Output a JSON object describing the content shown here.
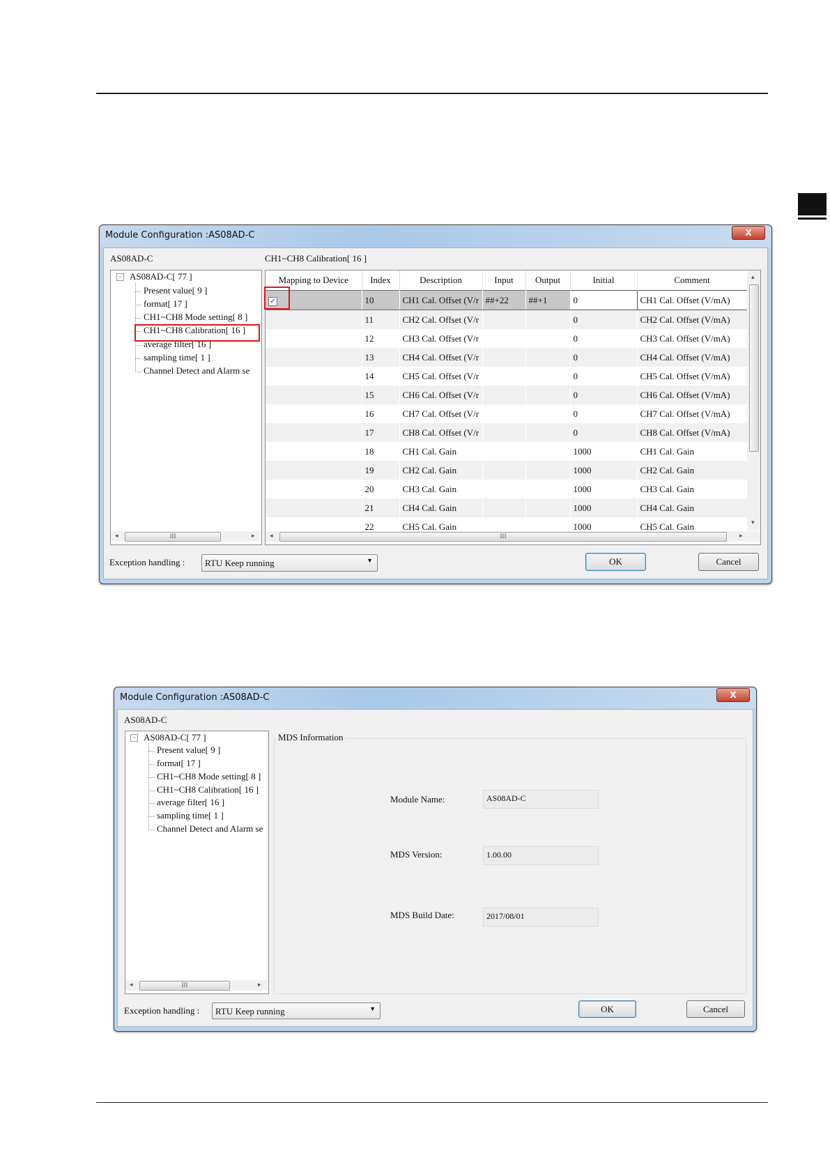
{
  "dialog1": {
    "title": "Module Configuration :AS08AD-C",
    "close_label": "X",
    "module_label": "AS08AD-C",
    "section_label": "CH1~CH8 Calibration[ 16 ]",
    "tree": {
      "root": "AS08AD-C[ 77 ]",
      "items": [
        "Present value[ 9 ]",
        "format[ 17 ]",
        "CH1~CH8 Mode setting[ 8 ]",
        "CH1~CH8 Calibration[ 16 ]",
        "average filter[ 16 ]",
        "sampling time[ 1 ]",
        "Channel Detect and Alarm se"
      ],
      "selected": "CH1~CH8 Calibration[ 16 ]"
    },
    "columns": [
      "Mapping to Device",
      "Index",
      "Description",
      "Input",
      "Output",
      "Initial",
      "Comment"
    ],
    "rows": [
      {
        "mapped": true,
        "index": "10",
        "description": "CH1 Cal. Offset (V/r",
        "input": "##+22",
        "output": "##+1",
        "initial": "0",
        "comment": "CH1 Cal. Offset (V/mA)"
      },
      {
        "mapped": false,
        "index": "11",
        "description": "CH2 Cal. Offset (V/r",
        "input": "",
        "output": "",
        "initial": "0",
        "comment": "CH2 Cal. Offset (V/mA)"
      },
      {
        "mapped": false,
        "index": "12",
        "description": "CH3 Cal. Offset (V/r",
        "input": "",
        "output": "",
        "initial": "0",
        "comment": "CH3 Cal. Offset (V/mA)"
      },
      {
        "mapped": false,
        "index": "13",
        "description": "CH4 Cal. Offset (V/r",
        "input": "",
        "output": "",
        "initial": "0",
        "comment": "CH4 Cal. Offset (V/mA)"
      },
      {
        "mapped": false,
        "index": "14",
        "description": "CH5 Cal. Offset (V/r",
        "input": "",
        "output": "",
        "initial": "0",
        "comment": "CH5 Cal. Offset (V/mA)"
      },
      {
        "mapped": false,
        "index": "15",
        "description": "CH6 Cal. Offset (V/r",
        "input": "",
        "output": "",
        "initial": "0",
        "comment": "CH6 Cal. Offset (V/mA)"
      },
      {
        "mapped": false,
        "index": "16",
        "description": "CH7 Cal. Offset (V/r",
        "input": "",
        "output": "",
        "initial": "0",
        "comment": "CH7 Cal. Offset (V/mA)"
      },
      {
        "mapped": false,
        "index": "17",
        "description": "CH8 Cal. Offset (V/r",
        "input": "",
        "output": "",
        "initial": "0",
        "comment": "CH8 Cal. Offset (V/mA)"
      },
      {
        "mapped": false,
        "index": "18",
        "description": "CH1 Cal. Gain",
        "input": "",
        "output": "",
        "initial": "1000",
        "comment": "CH1 Cal. Gain"
      },
      {
        "mapped": false,
        "index": "19",
        "description": "CH2 Cal. Gain",
        "input": "",
        "output": "",
        "initial": "1000",
        "comment": "CH2 Cal. Gain"
      },
      {
        "mapped": false,
        "index": "20",
        "description": "CH3 Cal. Gain",
        "input": "",
        "output": "",
        "initial": "1000",
        "comment": "CH3 Cal. Gain"
      },
      {
        "mapped": false,
        "index": "21",
        "description": "CH4 Cal. Gain",
        "input": "",
        "output": "",
        "initial": "1000",
        "comment": "CH4 Cal. Gain"
      },
      {
        "mapped": false,
        "index": "22",
        "description": "CH5 Cal. Gain",
        "input": "",
        "output": "",
        "initial": "1000",
        "comment": "CH5 Cal. Gain"
      }
    ],
    "exception_label": "Exception handling :",
    "exception_value": "RTU Keep running",
    "ok_label": "OK",
    "cancel_label": "Cancel"
  },
  "dialog2": {
    "title": "Module Configuration :AS08AD-C",
    "close_label": "X",
    "module_label": "AS08AD-C",
    "tree": {
      "root": "AS08AD-C[ 77 ]",
      "items": [
        "Present value[ 9 ]",
        "format[ 17 ]",
        "CH1~CH8 Mode setting[ 8 ]",
        "CH1~CH8 Calibration[ 16 ]",
        "average filter[ 16 ]",
        "sampling time[ 1 ]",
        "Channel Detect and Alarm se"
      ]
    },
    "group_title": "MDS Information",
    "fields": [
      {
        "label": "Module Name:",
        "value": "AS08AD-C"
      },
      {
        "label": "MDS Version:",
        "value": "1.00.00"
      },
      {
        "label": "MDS Build Date:",
        "value": "2017/08/01"
      }
    ],
    "exception_label": "Exception handling :",
    "exception_value": "RTU Keep running",
    "ok_label": "OK",
    "cancel_label": "Cancel"
  },
  "colors": {
    "highlight": "#e0141c",
    "titlebar": "#a9c9e8"
  }
}
